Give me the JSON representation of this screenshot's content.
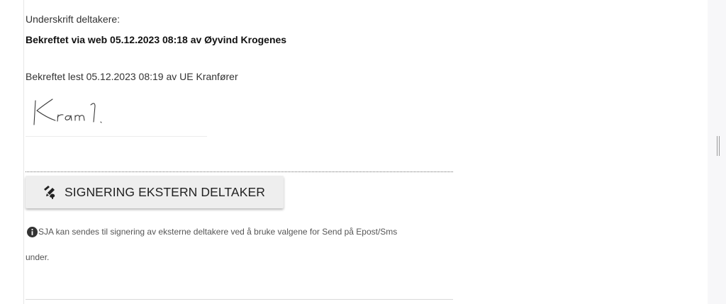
{
  "participants": {
    "signature_label": "Underskrift deltakere:",
    "confirmed_via_web": "Bekreftet via web 05.12.2023 08:18 av Øyvind Krogenes",
    "confirmed_read": "Bekreftet lest 05.12.2023 08:19 av UE Kranfører",
    "signature_text": "Kran 1."
  },
  "actions": {
    "external_signing_label": "SIGNERING EKSTERN DELTAKER",
    "external_signing_icon": "signature-pen-icon"
  },
  "info": {
    "icon": "info-circle-icon",
    "text_line1": "SJA kan sendes til signering av eksterne deltakere ved å bruke valgene for Send på Epost/Sms",
    "text_line2": "under."
  },
  "colors": {
    "button_bg": "#eeeeee",
    "right_panel_bg": "#f7f7f9"
  }
}
